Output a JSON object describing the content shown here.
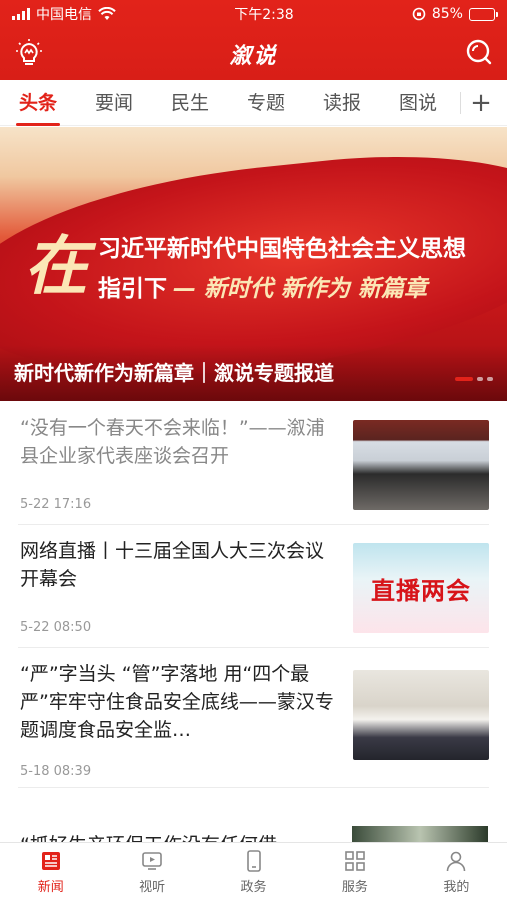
{
  "status": {
    "carrier": "中国电信",
    "time": "下午2:38",
    "battery": "85%",
    "battery_level": 0.85
  },
  "header": {
    "brand": "溆说",
    "bulb_icon": "lightbulb-icon",
    "search_icon": "search-icon"
  },
  "tabs": [
    {
      "label": "头条",
      "active": true
    },
    {
      "label": "要闻"
    },
    {
      "label": "民生"
    },
    {
      "label": "专题"
    },
    {
      "label": "读报"
    },
    {
      "label": "图说"
    }
  ],
  "tabs_more": "+",
  "banner": {
    "big_char": "在",
    "line1": "习近平新时代中国特色社会主义思想",
    "line2_a": "指引下",
    "line2_b": "— 新时代  新作为  新篇章",
    "caption": "新时代新作为新篇章｜溆说专题报道"
  },
  "news": [
    {
      "title": "“没有一个春天不会来临！”——溆浦县企业家代表座谈会召开",
      "time": "5-22 17:16",
      "read": true
    },
    {
      "title": "网络直播丨十三届全国人大三次会议开幕会",
      "time": "5-22 08:50",
      "thumb_text": "直播两会"
    },
    {
      "title": "“严”字当头 “管”字落地  用“四个最严”牢牢守住食品安全底线——蒙汉专题调度食品安全监…",
      "time": "5-18 08:39"
    }
  ],
  "partial_item": {
    "title": "“抓好生产环保工作没有任何借"
  },
  "bottom_nav": [
    {
      "label": "新闻",
      "icon": "newspaper-icon",
      "active": true
    },
    {
      "label": "视听",
      "icon": "video-icon"
    },
    {
      "label": "政务",
      "icon": "phone-icon"
    },
    {
      "label": "服务",
      "icon": "grid-icon"
    },
    {
      "label": "我的",
      "icon": "user-icon"
    }
  ]
}
